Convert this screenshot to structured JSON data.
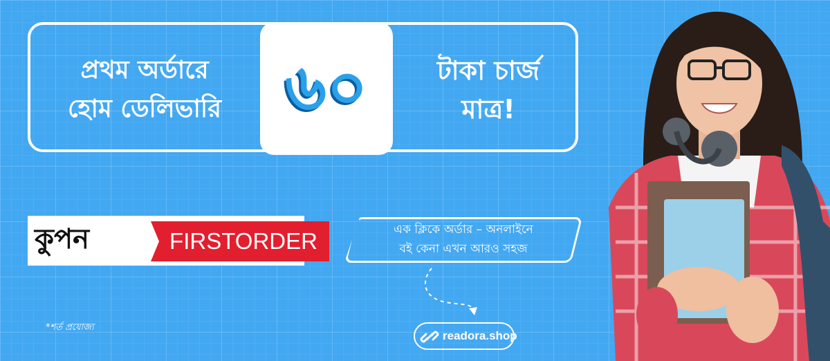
{
  "offer": {
    "left_line1": "প্রথম অর্ডারে",
    "left_line2": "হোম ডেলিভারি",
    "price": "৬০",
    "right_line1": "টাকা চার্জ",
    "right_line2": "মাত্র!"
  },
  "coupon": {
    "label": "কুপন",
    "code": "FIRSTORDER"
  },
  "tagline": {
    "line1": "এক ক্লিকে অর্ডার – অনলাইনে",
    "line2": "বই কেনা এখন আরও সহজ"
  },
  "note": "*শর্ত প্রযোজ্য",
  "brand": {
    "name": "readora.shop",
    "icon": "chain-link-icon"
  },
  "colors": {
    "background": "#43a8f2",
    "accent_red": "#e21f2f",
    "price_blue": "#2aa0ec"
  }
}
